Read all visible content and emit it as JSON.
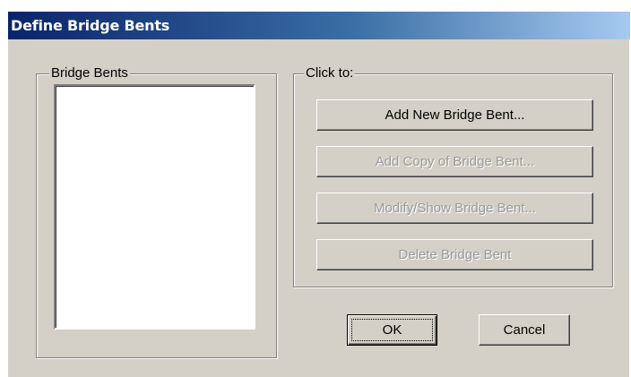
{
  "window": {
    "title": "Define Bridge Bents"
  },
  "bents_group": {
    "legend": "Bridge Bents",
    "items": []
  },
  "actions_group": {
    "legend": "Click to:",
    "add_new_label": "Add New Bridge Bent...",
    "add_copy_label": "Add Copy of Bridge Bent...",
    "modify_label": "Modify/Show Bridge Bent...",
    "delete_label": "Delete Bridge Bent"
  },
  "footer": {
    "ok_label": "OK",
    "cancel_label": "Cancel"
  },
  "colors": {
    "dialog_face": "#d4d0c8",
    "titlebar_start": "#0a246a",
    "titlebar_end": "#a6caf0",
    "disabled_text": "#9a9a9a"
  }
}
